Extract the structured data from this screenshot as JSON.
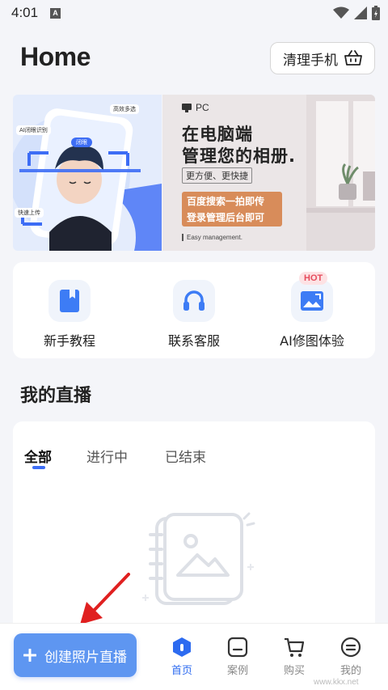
{
  "status_bar": {
    "time": "4:01",
    "notif_letter": "A"
  },
  "header": {
    "title": "Home",
    "clean_button": "清理手机"
  },
  "banner": {
    "left": {
      "tag_top": "高效多选",
      "tag_ai": "AI闭眼识别",
      "chip": "闭眼",
      "tag_bottom": "快速上传"
    },
    "right": {
      "pc_label": "PC",
      "headline_1": "在电脑端",
      "headline_2": "管理您的相册.",
      "subline": "更方便、更快捷",
      "cta_1": "百度搜索一拍即传",
      "cta_2": "登录管理后台即可",
      "footer": "Easy management."
    }
  },
  "quick_actions": [
    {
      "label": "新手教程",
      "icon": "bookmark-icon"
    },
    {
      "label": "联系客服",
      "icon": "headset-icon"
    },
    {
      "label": "AI修图体验",
      "icon": "image-edit-icon",
      "badge": "HOT"
    }
  ],
  "live_section": {
    "title": "我的直播",
    "tabs": [
      "全部",
      "进行中",
      "已结束"
    ],
    "active_tab": 0
  },
  "bottom": {
    "create_button": "创建照片直播",
    "nav": [
      {
        "label": "首页",
        "icon": "home-icon",
        "active": true
      },
      {
        "label": "案例",
        "icon": "case-icon",
        "active": false
      },
      {
        "label": "购买",
        "icon": "cart-icon",
        "active": false
      },
      {
        "label": "我的",
        "icon": "profile-icon",
        "active": false
      }
    ]
  },
  "watermark": "www.kkx.net",
  "colors": {
    "accent": "#2d6bf0",
    "create_button": "#5e96f1",
    "hot": "#e64b5c",
    "arrow": "#e02020"
  }
}
